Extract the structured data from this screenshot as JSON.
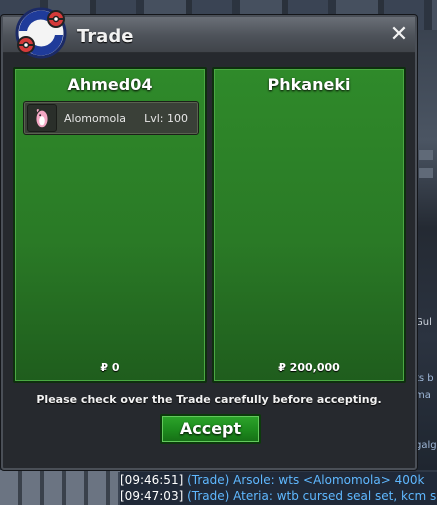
{
  "window": {
    "title": "Trade",
    "close_symbol": "✕"
  },
  "trade": {
    "left": {
      "player": "Ahmed04",
      "money": "₽ 0",
      "items": [
        {
          "name": "Alomomola",
          "level": "Lvl: 100",
          "icon": "alomomola-sprite-icon"
        }
      ]
    },
    "right": {
      "player": "Phkaneki",
      "money": "₽ 200,000",
      "items": []
    },
    "notice": "Please check over the Trade carefully before accepting.",
    "accept_label": "Accept"
  },
  "chat": {
    "lines": [
      {
        "time": "[09:46:51]",
        "text": "(Trade) Arsole: wts <Alomomola> 400k"
      },
      {
        "time": "[09:47:03]",
        "text": "(Trade) Ateria: wtb cursed seal set, kcm set, ..."
      }
    ]
  },
  "background_snippets": [
    "ts b",
    "ma",
    "Gul",
    "galg"
  ],
  "colors": {
    "panel_green": "#2f8a2a",
    "accept_green": "#1d8a1d",
    "chat_blue": "#5fb8ff"
  }
}
